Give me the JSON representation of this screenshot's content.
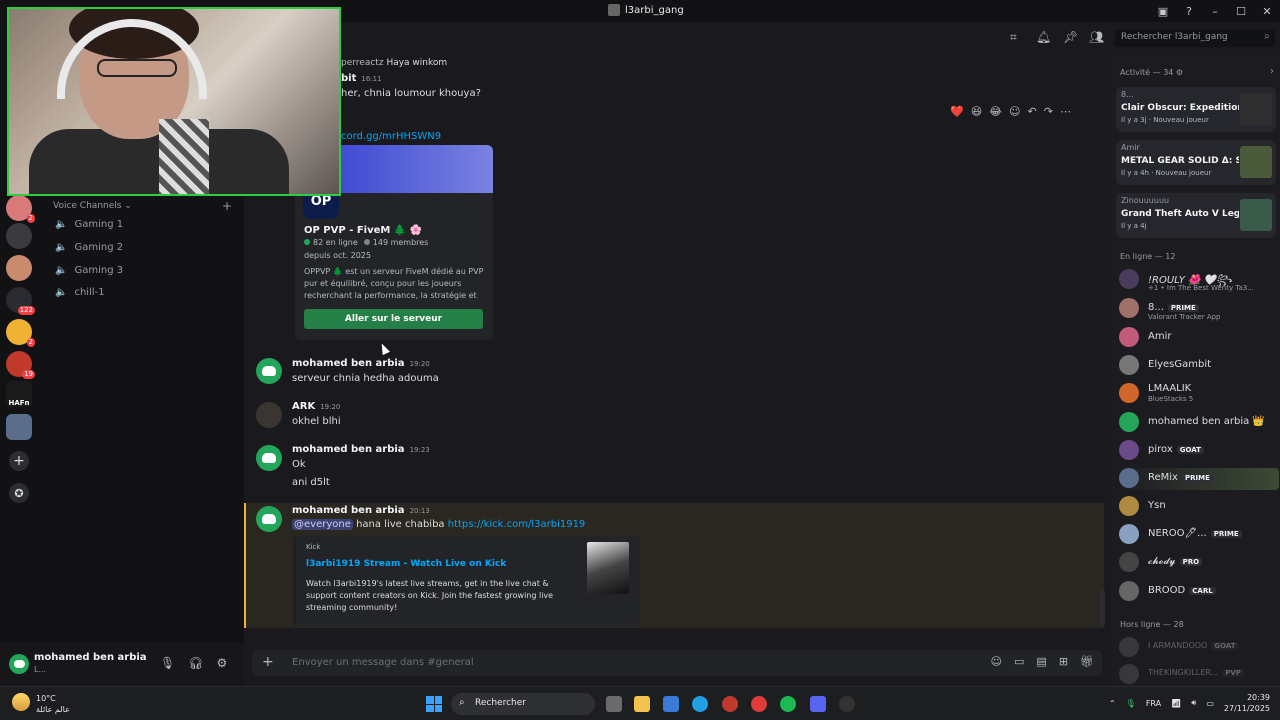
{
  "window": {
    "title": "l3arbi_gang",
    "minimize": "–",
    "maximize": "☐",
    "close": "✕"
  },
  "servers": [
    {
      "badge": "2",
      "color": "#d97a7a"
    },
    {
      "badge": "",
      "color": "#3a3a3e"
    },
    {
      "badge": "",
      "color": "#c98a6e"
    },
    {
      "badge": "122",
      "color": "#2a2b30"
    },
    {
      "badge": "2",
      "color": "#f0b232"
    },
    {
      "badge": "19",
      "color": "#c0392b"
    },
    {
      "badge": "",
      "color": "#1a1a1a"
    },
    {
      "badge": "",
      "color": "#5a6e8c"
    }
  ],
  "server_labels": {
    "hafn": "HAFn"
  },
  "voice": {
    "header": "Voice Channels ⌄",
    "add": "+",
    "channels": [
      "Gaming 1",
      "Gaming 2",
      "Gaming 3",
      "chill-1"
    ]
  },
  "search": {
    "placeholder": "Rechercher l3arbi_gang",
    "icon": "⌕"
  },
  "messages": {
    "partial1_name": "perreactz",
    "partial1_text": "Haya winkom",
    "partial2_name": "bit",
    "partial2_time": "16:11",
    "partial2_text": "her, chnia loumour khouya?",
    "partial_link": "cord.gg/mrHHSWN9",
    "m1": {
      "name": "mohamed ben arbia",
      "time": "19:20",
      "text": "serveur chnia hedha adouma"
    },
    "m2": {
      "name": "ARK",
      "time": "19:20",
      "text": "okhel blhi"
    },
    "m3": {
      "name": "mohamed ben arbia",
      "time": "19:23",
      "text1": "Ok",
      "text2": "ani d5lt"
    },
    "m4": {
      "name": "mohamed ben arbia",
      "time": "20:13",
      "mention": "@everyone",
      "text": "hana live chabiba",
      "link": "https://kick.com/l3arbi1919"
    }
  },
  "invite": {
    "logo": "OP",
    "name": "OP PVP - FiveM 🌲 🌸",
    "online": "82 en ligne",
    "members": "149 membres",
    "since": "depuis oct. 2025",
    "desc": "OPPVP 🌲 est un serveur FiveM dédié au PVP pur et équilibré, conçu pour les joueurs recherchant la performance, la stratégie et",
    "button": "Aller sur le serveur"
  },
  "reactions": [
    "❤️",
    "😆",
    "😂",
    "☺",
    "↶",
    "↷",
    "⋯"
  ],
  "embed": {
    "provider": "Kick",
    "title": "l3arbi1919 Stream - Watch Live on Kick",
    "desc": "Watch l3arbi1919's latest live streams, get in the live chat & support content creators on Kick. Join the fastest growing live streaming community!"
  },
  "composer": {
    "placeholder": "Envoyer un message dans #general",
    "plus": "+"
  },
  "user": {
    "name": "mohamed ben arbia",
    "status": "L..."
  },
  "members": {
    "activity_header": "Activité — 34 ⚙",
    "activities": [
      {
        "who": "8...",
        "game": "Clair Obscur: Expedition 33",
        "meta": "Il y a 3j  ·  Nouveau joueur",
        "art": "#3a3a3a"
      },
      {
        "who": "Amir",
        "game": "METAL GEAR SOLID Δ: SN...",
        "meta": "Il y a 4h  ·  Nouveau joueur",
        "art": "#4a5a3a"
      },
      {
        "who": "Zinouuuuuu",
        "game": "Grand Theft Auto V Legacy",
        "meta": "Il y a 4j",
        "art": "#3a5a4a"
      }
    ],
    "online_header": "En ligne — 12",
    "online": [
      {
        "name": "!ROULY 🌺 🤍꧂",
        "status": "+1 • Im The Best Wenty Ta3...",
        "tag": "",
        "color": "#4a3c5c"
      },
      {
        "name": "8...",
        "status": "Valorant Tracker App",
        "tag": "PRIME",
        "color": "#a0706a"
      },
      {
        "name": "Amir",
        "status": "",
        "tag": "",
        "color": "#c25a7a"
      },
      {
        "name": "ElyesGambit",
        "status": "",
        "tag": "",
        "color": "#777"
      },
      {
        "name": "LMAALIK",
        "status": "BlueStacks 5",
        "tag": "",
        "color": "#d0662a"
      },
      {
        "name": "mohamed ben arbia 👑",
        "status": "",
        "tag": "",
        "color": "#23a55a"
      },
      {
        "name": "pirox",
        "status": "",
        "tag": "GOAT",
        "color": "#6a4a8a"
      },
      {
        "name": "ReMix",
        "status": "",
        "tag": "PRIME",
        "color": "#5a6e8c"
      },
      {
        "name": "Ysn",
        "status": "",
        "tag": "",
        "color": "#b08a40"
      },
      {
        "name": "NEROO🖊...",
        "status": "",
        "tag": "PRIME",
        "color": "#8aa0c0"
      },
      {
        "name": "𝓬𝓱𝓸𝓭𝔂",
        "status": "",
        "tag": "PRO",
        "color": "#444"
      },
      {
        "name": "BROOD",
        "status": "",
        "tag": "CARL",
        "color": "#666"
      }
    ],
    "offline_header": "Hors ligne — 28",
    "offline": [
      {
        "name": "I ARMANDOOO",
        "tag": "GOAT"
      },
      {
        "name": "THEKINGKILLER...",
        "tag": "PVP"
      }
    ]
  },
  "taskbar": {
    "temp": "10°C",
    "weather": "عالم عائلة",
    "search": "Rechercher",
    "lang": "FRA",
    "time": "20:39",
    "date": "27/11/2025"
  }
}
